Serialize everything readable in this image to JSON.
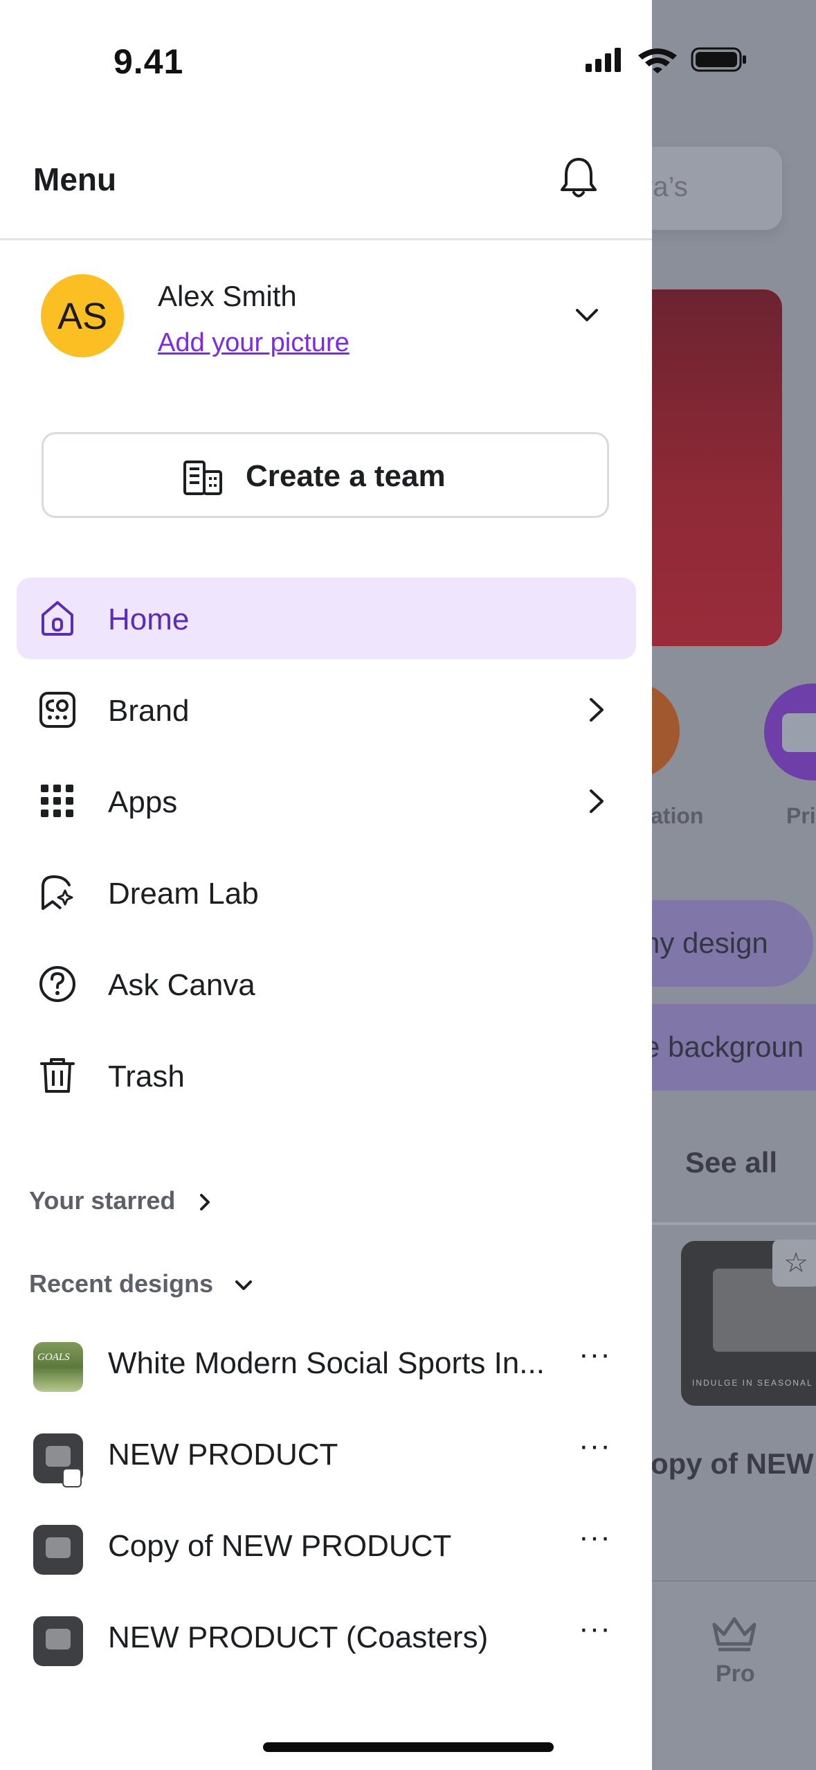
{
  "status": {
    "time": "9.41"
  },
  "background": {
    "search_partial": "ra’s",
    "label_left": "ation",
    "label_right": "Pri",
    "pill_design": "ny design",
    "pill_background": "e backgroun",
    "see_all": "See all",
    "design_title_partial": "opy of NEW",
    "thumb_text": "INDULGE IN SEASONAL DELIG",
    "pro_label": "Pro",
    "star_glyph": "☆"
  },
  "drawer": {
    "title": "Menu",
    "user": {
      "initials": "AS",
      "name": "Alex Smith",
      "add_picture": "Add your picture",
      "avatar_color": "#fbbf24"
    },
    "create_team": "Create a team",
    "nav": [
      {
        "label": "Home",
        "icon": "home-icon",
        "active": true,
        "arrow": false
      },
      {
        "label": "Brand",
        "icon": "brand-icon",
        "active": false,
        "arrow": true
      },
      {
        "label": "Apps",
        "icon": "apps-grid-icon",
        "active": false,
        "arrow": true
      },
      {
        "label": "Dream Lab",
        "icon": "dream-lab-icon",
        "active": false,
        "arrow": false
      },
      {
        "label": "Ask Canva",
        "icon": "help-icon",
        "active": false,
        "arrow": false
      },
      {
        "label": "Trash",
        "icon": "trash-icon",
        "active": false,
        "arrow": false
      }
    ],
    "starred_label": "Your starred",
    "recent_label": "Recent designs",
    "recent": [
      {
        "title": "White Modern Social Sports In...",
        "thumb_text": "GOALS"
      },
      {
        "title": "NEW PRODUCT"
      },
      {
        "title": "Copy of NEW PRODUCT"
      },
      {
        "title": "NEW PRODUCT (Coasters)"
      }
    ],
    "more_glyph": "···"
  },
  "colors": {
    "accent": "#7d2ae8",
    "active_bg": "#efe6fd",
    "active_text": "#5a2db8"
  }
}
